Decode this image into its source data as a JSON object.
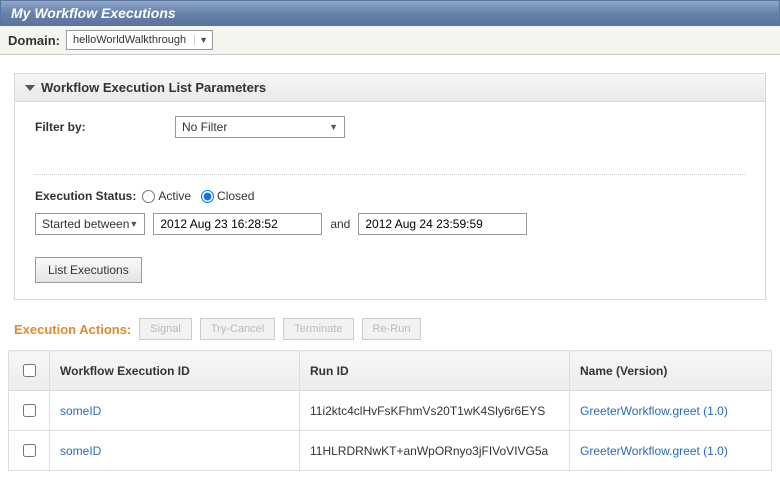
{
  "title": "My Workflow Executions",
  "domain": {
    "label": "Domain:",
    "value": "helloWorldWalkthrough"
  },
  "panel": {
    "title": "Workflow Execution List Parameters",
    "filter": {
      "label": "Filter by:",
      "value": "No Filter"
    },
    "status": {
      "label": "Execution Status:",
      "active": "Active",
      "closed": "Closed",
      "selected": "closed"
    },
    "date": {
      "modeLabel": "Started between",
      "from": "2012 Aug 23 16:28:52",
      "and": "and",
      "to": "2012 Aug 24 23:59:59"
    },
    "listBtn": "List Executions"
  },
  "actions": {
    "label": "Execution Actions:",
    "buttons": [
      "Signal",
      "Try-Cancel",
      "Terminate",
      "Re-Run"
    ]
  },
  "table": {
    "headers": {
      "wf": "Workflow Execution ID",
      "run": "Run ID",
      "name": "Name (Version)"
    },
    "rows": [
      {
        "wf": "someID",
        "run": "11i2ktc4clHvFsKFhmVs20T1wK4Sly6r6EYS",
        "name": "GreeterWorkflow.greet (1.0)"
      },
      {
        "wf": "someID",
        "run": "11HLRDRNwKT+anWpORnyo3jFIVoVIVG5a",
        "name": "GreeterWorkflow.greet (1.0)"
      }
    ]
  }
}
